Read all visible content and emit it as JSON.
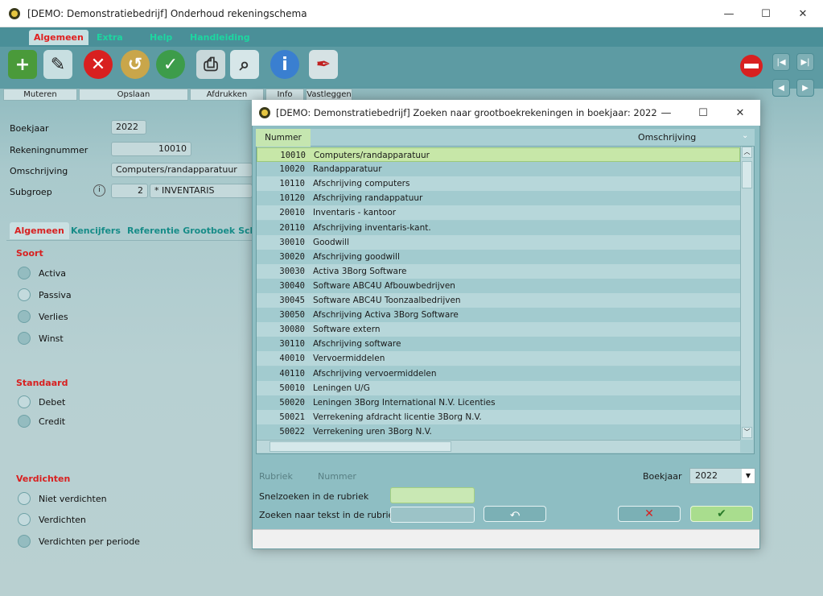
{
  "window": {
    "title": "[DEMO: Demonstratiebedrijf]  Onderhoud rekeningschema",
    "controls": {
      "minimize": "—",
      "maximize": "☐",
      "close": "✕"
    }
  },
  "menu": [
    "Algemeen",
    "Extra",
    "Help",
    "Handleiding"
  ],
  "toolbar": {
    "groups": [
      "Muteren",
      "Opslaan",
      "Afdrukken",
      "Info",
      "Vastleggen"
    ],
    "icons": [
      "add-icon",
      "edit-icon",
      "cancel-icon",
      "undo-icon",
      "confirm-icon",
      "print-icon",
      "preview-icon",
      "info-icon",
      "sign-icon"
    ]
  },
  "form": {
    "boekjaar_label": "Boekjaar",
    "boekjaar_value": "2022",
    "rekeningnummer_label": "Rekeningnummer",
    "rekeningnummer_value": "10010",
    "omschrijving_label": "Omschrijving",
    "omschrijving_value": "Computers/randapparatuur",
    "subgroep_label": "Subgroep",
    "subgroep_number": "2",
    "subgroep_value": "* INVENTARIS"
  },
  "tabs": [
    "Algemeen",
    "Kencijfers",
    "Referentie Grootboek Scher"
  ],
  "soort": {
    "title": "Soort",
    "options": [
      "Activa",
      "Passiva",
      "Verlies",
      "Winst"
    ]
  },
  "standaard": {
    "title": "Standaard",
    "options": [
      "Debet",
      "Credit"
    ]
  },
  "verdichten": {
    "title": "Verdichten",
    "options": [
      "Niet verdichten",
      "Verdichten",
      "Verdichten per periode"
    ]
  },
  "dialog": {
    "title": "[DEMO: Demonstratiebedrijf]  Zoeken naar grootboekrekeningen in boekjaar: 2022",
    "columns": {
      "nummer": "Nummer",
      "omschrijving": "Omschrijving"
    },
    "rows": [
      {
        "num": "10010",
        "oms": "Computers/randapparatuur"
      },
      {
        "num": "10020",
        "oms": "Randapparatuur"
      },
      {
        "num": "10110",
        "oms": "Afschrijving computers"
      },
      {
        "num": "10120",
        "oms": "Afschrijving randappatuur"
      },
      {
        "num": "20010",
        "oms": "Inventaris - kantoor"
      },
      {
        "num": "20110",
        "oms": "Afschrijving inventaris-kant."
      },
      {
        "num": "30010",
        "oms": "Goodwill"
      },
      {
        "num": "30020",
        "oms": "Afschrijving goodwill"
      },
      {
        "num": "30030",
        "oms": "Activa 3Borg Software"
      },
      {
        "num": "30040",
        "oms": "Software ABC4U Afbouwbedrijven"
      },
      {
        "num": "30045",
        "oms": "Software ABC4U Toonzaalbedrijven"
      },
      {
        "num": "30050",
        "oms": "Afschrijving Activa 3Borg Software"
      },
      {
        "num": "30080",
        "oms": "Software extern"
      },
      {
        "num": "30110",
        "oms": "Afschrijving software"
      },
      {
        "num": "40010",
        "oms": "Vervoermiddelen"
      },
      {
        "num": "40110",
        "oms": "Afschrijving vervoermiddelen"
      },
      {
        "num": "50010",
        "oms": "Leningen U/G"
      },
      {
        "num": "50020",
        "oms": "Leningen 3Borg International N.V. Licenties"
      },
      {
        "num": "50021",
        "oms": "Verrekening afdracht licentie 3Borg N.V."
      },
      {
        "num": "50022",
        "oms": "Verrekening uren 3Borg N.V."
      }
    ],
    "rubriek_label": "Rubriek",
    "rubriek_value": "Nummer",
    "boekjaar_label": "Boekjaar",
    "boekjaar_value": "2022",
    "snelzoeken_label": "Snelzoeken in de rubriek",
    "zoeken_label": "Zoeken naar tekst in de rubriek"
  },
  "colors": {
    "accent_red": "#d82020",
    "teal": "#4a8f98",
    "selected_row": "#c7e7a8"
  }
}
